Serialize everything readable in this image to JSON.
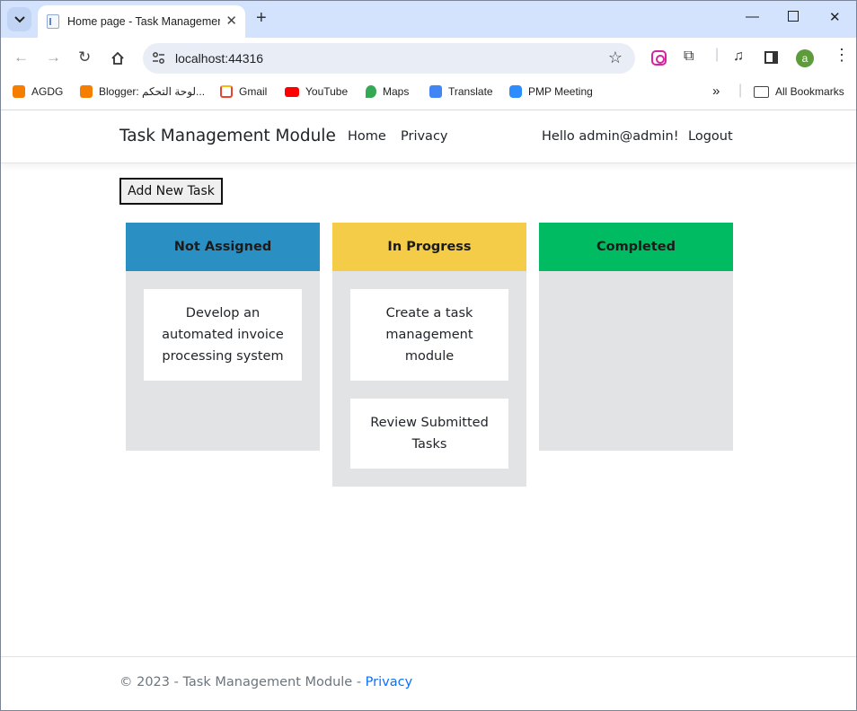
{
  "browser": {
    "tab_title": "Home page - Task Management Module",
    "url": "localhost:44316",
    "profile_initial": "a",
    "bookmarks": [
      {
        "label": "AGDG",
        "icon": "blogger-icon",
        "color": "#f57d00"
      },
      {
        "label": "Blogger: لوحة التحكم...",
        "icon": "blogger-icon",
        "color": "#f57d00"
      },
      {
        "label": "Gmail",
        "icon": "gmail-icon",
        "color": "#ea4335"
      },
      {
        "label": "YouTube",
        "icon": "youtube-icon",
        "color": "#ff0000"
      },
      {
        "label": "Maps",
        "icon": "maps-icon",
        "color": "#34a853"
      },
      {
        "label": "Translate",
        "icon": "translate-icon",
        "color": "#4285f4"
      },
      {
        "label": "PMP Meeting",
        "icon": "zoom-icon",
        "color": "#2d8cff"
      }
    ],
    "all_bookmarks": "All Bookmarks"
  },
  "navbar": {
    "brand": "Task Management Module",
    "links": [
      "Home",
      "Privacy"
    ],
    "greeting": "Hello admin@admin!",
    "logout": "Logout"
  },
  "add_task_label": "Add New Task",
  "columns": [
    {
      "title": "Not Assigned",
      "color": "#2a90c3",
      "tasks": [
        "Develop an automated invoice processing system"
      ]
    },
    {
      "title": "In Progress",
      "color": "#f4cc47",
      "tasks": [
        "Create a task management module",
        "Review Submitted Tasks"
      ]
    },
    {
      "title": "Completed",
      "color": "#00bb62",
      "tasks": []
    }
  ],
  "footer": {
    "text": "© 2023 - Task Management Module - ",
    "link": "Privacy"
  }
}
